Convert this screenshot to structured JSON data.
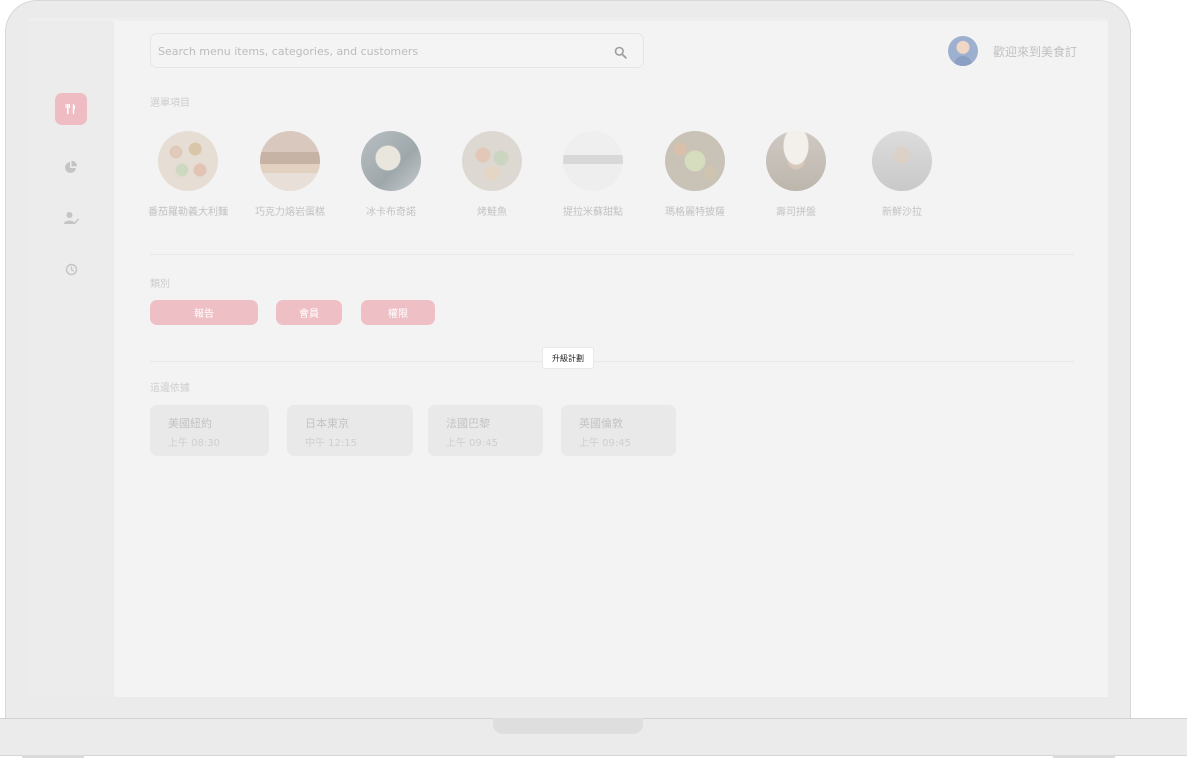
{
  "search": {
    "placeholder": "Search menu items, categories, and customers",
    "icon": "search-icon"
  },
  "header": {
    "welcome": "歡迎來到美食訂"
  },
  "sidebar": {
    "items": [
      {
        "icon": "utensils-icon",
        "active": true
      },
      {
        "icon": "pie-chart-icon",
        "active": false
      },
      {
        "icon": "user-edit-icon",
        "active": false
      },
      {
        "icon": "history-icon",
        "active": false
      }
    ]
  },
  "menu_section": {
    "label": "選單項目",
    "items": [
      {
        "name": "番茄羅勒義大利麵"
      },
      {
        "name": "巧克力熔岩蛋糕"
      },
      {
        "name": "冰卡布奇諾"
      },
      {
        "name": "烤鮭魚"
      },
      {
        "name": "提拉米蘇甜點"
      },
      {
        "name": "瑪格麗特披薩"
      },
      {
        "name": "壽司拼盤"
      },
      {
        "name": "新鮮沙拉"
      }
    ]
  },
  "category_section": {
    "label": "類別",
    "items": [
      "報告",
      "會員",
      "權限"
    ]
  },
  "tooltip": "升級計劃",
  "timezone_section": {
    "label": "這邊依據",
    "items": [
      {
        "city": "美國紐約",
        "time": "上午 08:30"
      },
      {
        "city": "日本東京",
        "time": "中午 12:15"
      },
      {
        "city": "法國巴黎",
        "time": "上午 09:45"
      },
      {
        "city": "英國倫敦",
        "time": "上午 09:45"
      }
    ]
  },
  "colors": {
    "accent": "#eebcc2",
    "background": "#f3f3f3"
  }
}
